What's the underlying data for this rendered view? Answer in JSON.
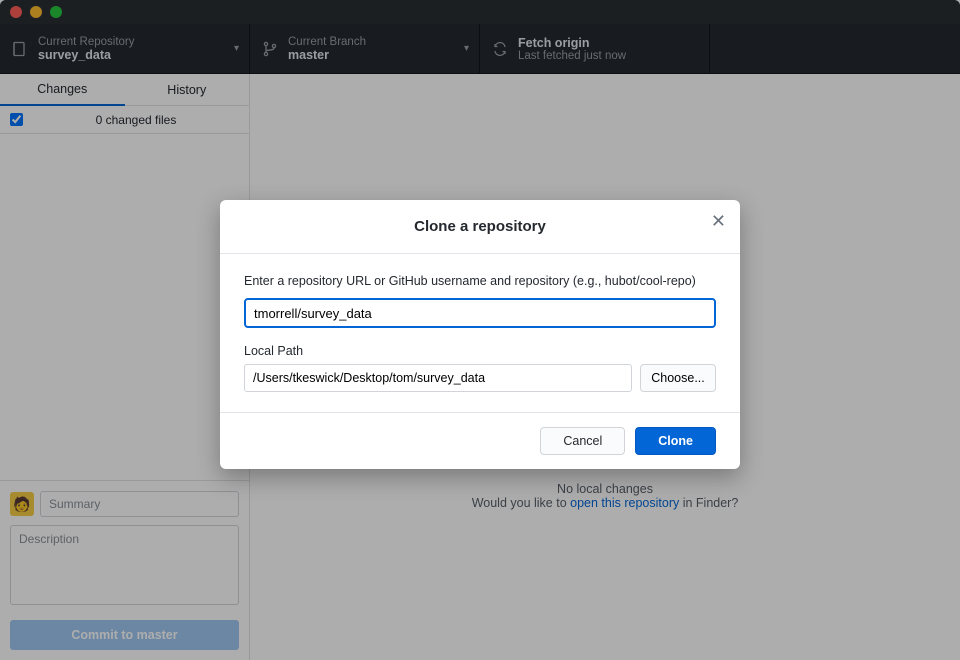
{
  "toolbar": {
    "repo": {
      "label": "Current Repository",
      "value": "survey_data"
    },
    "branch": {
      "label": "Current Branch",
      "value": "master"
    },
    "fetch": {
      "label": "Fetch origin",
      "value": "Last fetched just now"
    }
  },
  "tabs": {
    "changes": "Changes",
    "history": "History"
  },
  "changes_header": {
    "count": "0 changed files"
  },
  "commit": {
    "summary_placeholder": "Summary",
    "description_placeholder": "Description",
    "button": "Commit to master"
  },
  "empty": {
    "line1": "No local changes",
    "line2_a": "Would you like to ",
    "link": "open this repository",
    "line2_b": " in Finder?"
  },
  "modal": {
    "title": "Clone a repository",
    "instruction": "Enter a repository URL or GitHub username and repository (e.g., hubot/cool-repo)",
    "url_value": "tmorrell/survey_data",
    "local_path_label": "Local Path",
    "local_path_value": "/Users/tkeswick/Desktop/tom/survey_data",
    "choose": "Choose...",
    "cancel": "Cancel",
    "clone": "Clone"
  }
}
